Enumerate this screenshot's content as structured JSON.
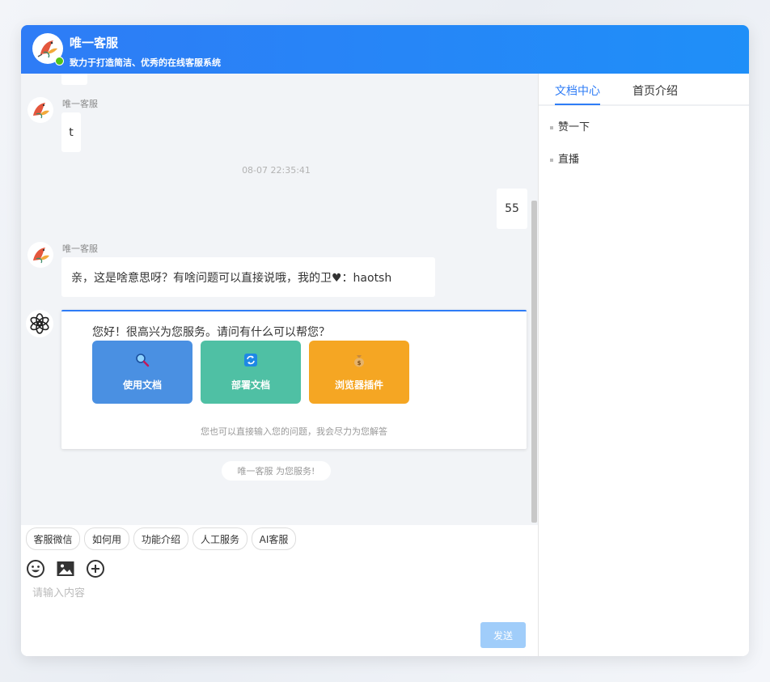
{
  "header": {
    "title": "唯一客服",
    "subtitle": "致力于打造简洁、优秀的在线客服系统",
    "logo_icon": "bird-logo-icon",
    "status_color": "#52c41a"
  },
  "chat": {
    "messages": [
      {
        "sender": "",
        "text": ""
      },
      {
        "sender": "唯一客服",
        "text": "t"
      },
      {
        "timestamp": "08-07 22:35:41"
      },
      {
        "sender": "me",
        "text": "55"
      },
      {
        "sender": "唯一客服",
        "text": "亲，这是啥意思呀？有啥问题可以直接说哦，我的卫♥：haotsh"
      }
    ],
    "ai_card": {
      "greeting": "您好！很高兴为您服务。请问有什么可以帮您？",
      "tiles": [
        {
          "label": "使用文档",
          "icon": "magnifier-icon",
          "color": "#4a90e2"
        },
        {
          "label": "部署文档",
          "icon": "refresh-icon",
          "color": "#4fc0a4"
        },
        {
          "label": "浏览器插件",
          "icon": "money-bag-icon",
          "color": "#f5a623"
        }
      ],
      "hint": "您也可以直接输入您的问题，我会尽力为您解答"
    },
    "service_pill": "唯一客服 为您服务!"
  },
  "quick_replies": [
    "客服微信",
    "如何用",
    "功能介绍",
    "人工服务",
    "AI客服"
  ],
  "toolbar": {
    "icons": [
      "emoji-icon",
      "image-icon",
      "add-circle-icon"
    ]
  },
  "input": {
    "placeholder": "请输入内容",
    "value": ""
  },
  "send_label": "发送",
  "sidebar": {
    "tabs": [
      {
        "label": "文档中心",
        "active": true
      },
      {
        "label": "首页介绍",
        "active": false
      }
    ],
    "items": [
      "赞一下",
      "直播"
    ]
  },
  "colors": {
    "primary": "#2e7cf6",
    "send_disabled": "#a0cdfa"
  }
}
